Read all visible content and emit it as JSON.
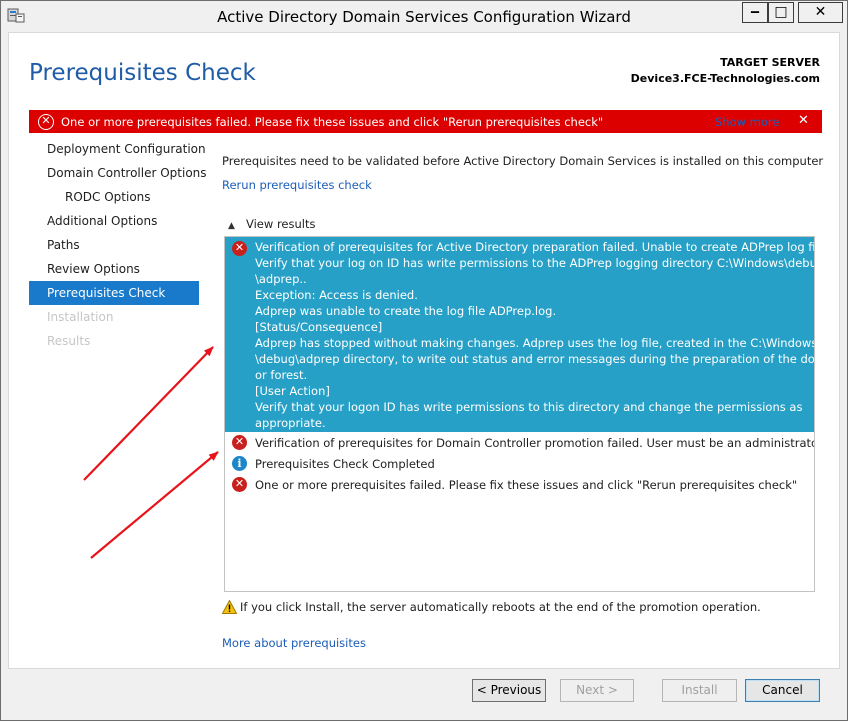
{
  "window": {
    "title": "Active Directory Domain Services Configuration Wizard",
    "minimize": "‒",
    "maximize": "□",
    "close": "✕"
  },
  "header": {
    "page_title": "Prerequisites Check",
    "target_server_label": "TARGET SERVER",
    "target_server_name": "Device3.FCE-Technologies.com"
  },
  "error_bar": {
    "message": "One or more prerequisites failed.  Please fix these issues and click \"Rerun prerequisites check\"",
    "show_more": "Show more",
    "close": "✕",
    "color": "#dc0000"
  },
  "nav": {
    "items": [
      {
        "label": "Deployment Configuration"
      },
      {
        "label": "Domain Controller Options"
      },
      {
        "label": "RODC Options"
      },
      {
        "label": "Additional Options"
      },
      {
        "label": "Paths"
      },
      {
        "label": "Review Options"
      },
      {
        "label": "Prerequisites Check"
      },
      {
        "label": "Installation"
      },
      {
        "label": "Results"
      }
    ]
  },
  "main": {
    "intro": "Prerequisites need to be validated before Active Directory Domain Services is installed on this computer",
    "rerun_link": "Rerun prerequisites check",
    "view_results": "View results",
    "results": [
      {
        "icon": "error-icon",
        "lines": [
          "Verification of prerequisites for Active Directory preparation failed. Unable to create ADPrep log files.",
          "Verify that your log on ID has write permissions to the ADPrep logging directory C:\\Windows\\debug",
          "\\adprep..",
          "Exception: Access is denied.",
          "Adprep was unable to create the log file ADPrep.log.",
          "[Status/Consequence]",
          "Adprep has stopped without making changes. Adprep uses the log file, created in the C:\\Windows",
          "\\debug\\adprep directory, to write out status and error messages during the preparation of the domain",
          "or forest.",
          "[User Action]",
          "Verify that your logon ID has write permissions to this directory and change the permissions as",
          "appropriate."
        ]
      },
      {
        "icon": "error-icon",
        "text": "Verification of prerequisites for Domain Controller promotion failed. User must be an administrator."
      },
      {
        "icon": "info-icon",
        "text": "Prerequisites Check Completed"
      },
      {
        "icon": "error-icon",
        "text": "One or more prerequisites failed.  Please fix these issues and click \"Rerun prerequisites check\""
      }
    ],
    "warning": "If you click Install, the server automatically reboots at the end of the promotion operation.",
    "more_link": "More about prerequisites"
  },
  "footer": {
    "previous": "< Previous",
    "next": "Next >",
    "install": "Install",
    "cancel": "Cancel"
  },
  "colors": {
    "accent": "#1979ca",
    "selection": "#26a0c6",
    "link": "#1d5db8",
    "annotation_arrow": "#e8141c"
  }
}
